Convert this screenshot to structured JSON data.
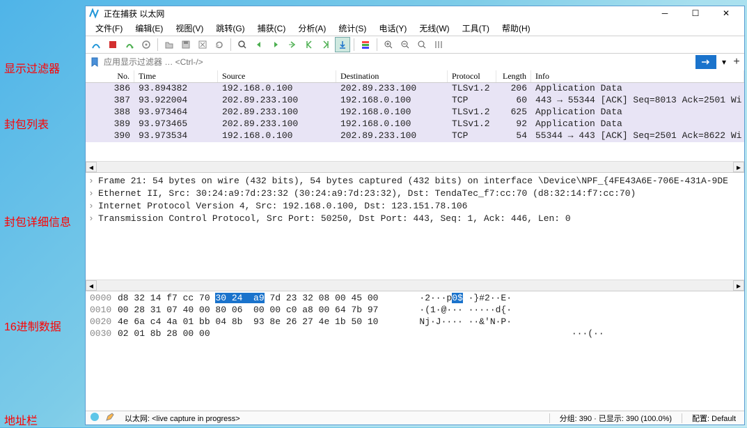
{
  "annotations": {
    "filter": "显示过滤器",
    "packet_list": "封包列表",
    "details": "封包详细信息",
    "hex": "16进制数据",
    "statusbar": "地址栏"
  },
  "window": {
    "title": "正在捕获 以太网"
  },
  "menu": {
    "file": "文件(F)",
    "edit": "编辑(E)",
    "view": "视图(V)",
    "go": "跳转(G)",
    "capture": "捕获(C)",
    "analyze": "分析(A)",
    "statistics": "统计(S)",
    "telephony": "电话(Y)",
    "wireless": "无线(W)",
    "tools": "工具(T)",
    "help": "帮助(H)"
  },
  "filter": {
    "placeholder": "应用显示过滤器 … <Ctrl-/>"
  },
  "columns": {
    "no": "No.",
    "time": "Time",
    "source": "Source",
    "destination": "Destination",
    "protocol": "Protocol",
    "length": "Length",
    "info": "Info"
  },
  "packets": [
    {
      "no": "386",
      "time": "93.894382",
      "src": "192.168.0.100",
      "dst": "202.89.233.100",
      "proto": "TLSv1.2",
      "len": "206",
      "info": "Application Data"
    },
    {
      "no": "387",
      "time": "93.922004",
      "src": "202.89.233.100",
      "dst": "192.168.0.100",
      "proto": "TCP",
      "len": "60",
      "info": "443 → 55344 [ACK] Seq=8013 Ack=2501 Wi"
    },
    {
      "no": "388",
      "time": "93.973464",
      "src": "202.89.233.100",
      "dst": "192.168.0.100",
      "proto": "TLSv1.2",
      "len": "625",
      "info": "Application Data"
    },
    {
      "no": "389",
      "time": "93.973465",
      "src": "202.89.233.100",
      "dst": "192.168.0.100",
      "proto": "TLSv1.2",
      "len": "92",
      "info": "Application Data"
    },
    {
      "no": "390",
      "time": "93.973534",
      "src": "192.168.0.100",
      "dst": "202.89.233.100",
      "proto": "TCP",
      "len": "54",
      "info": "55344 → 443 [ACK] Seq=2501 Ack=8622 Wi"
    }
  ],
  "details": [
    "Frame 21: 54 bytes on wire (432 bits), 54 bytes captured (432 bits) on interface \\Device\\NPF_{4FE43A6E-706E-431A-9DE",
    "Ethernet II, Src: 30:24:a9:7d:23:32 (30:24:a9:7d:23:32), Dst: TendaTec_f7:cc:70 (d8:32:14:f7:cc:70)",
    "Internet Protocol Version 4, Src: 192.168.0.100, Dst: 123.151.78.106",
    "Transmission Control Protocol, Src Port: 50250, Dst Port: 443, Seq: 1, Ack: 446, Len: 0"
  ],
  "hex": {
    "rows": [
      {
        "offset": "0000",
        "b1": "d8 32 14 f7 cc 70 ",
        "hl": "30 24  a9",
        "b2": " 7d 23 32 08 00 45 00",
        "ascii": "   ·2···p0$ ·}#2··E·"
      },
      {
        "offset": "0010",
        "b1": "00 28 31 07 40 00 80 06  00 00 c0 a8 00 64 7b 97",
        "hl": "",
        "b2": "",
        "ascii": "   ·(1·@··· ·····d{·"
      },
      {
        "offset": "0020",
        "b1": "4e 6a c4 4a 01 bb 04 8b  93 8e 26 27 4e 1b 50 10",
        "hl": "",
        "b2": "",
        "ascii": "   Nj·J···· ··&'N·P·"
      },
      {
        "offset": "0030",
        "b1": "02 01 8b 28 00 00",
        "hl": "",
        "b2": "",
        "ascii": "                               ···(··"
      }
    ]
  },
  "statusbar": {
    "interface": "以太网: <live capture in progress>",
    "packets": "分组: 390 · 已显示: 390 (100.0%)",
    "profile": "配置: Default"
  }
}
